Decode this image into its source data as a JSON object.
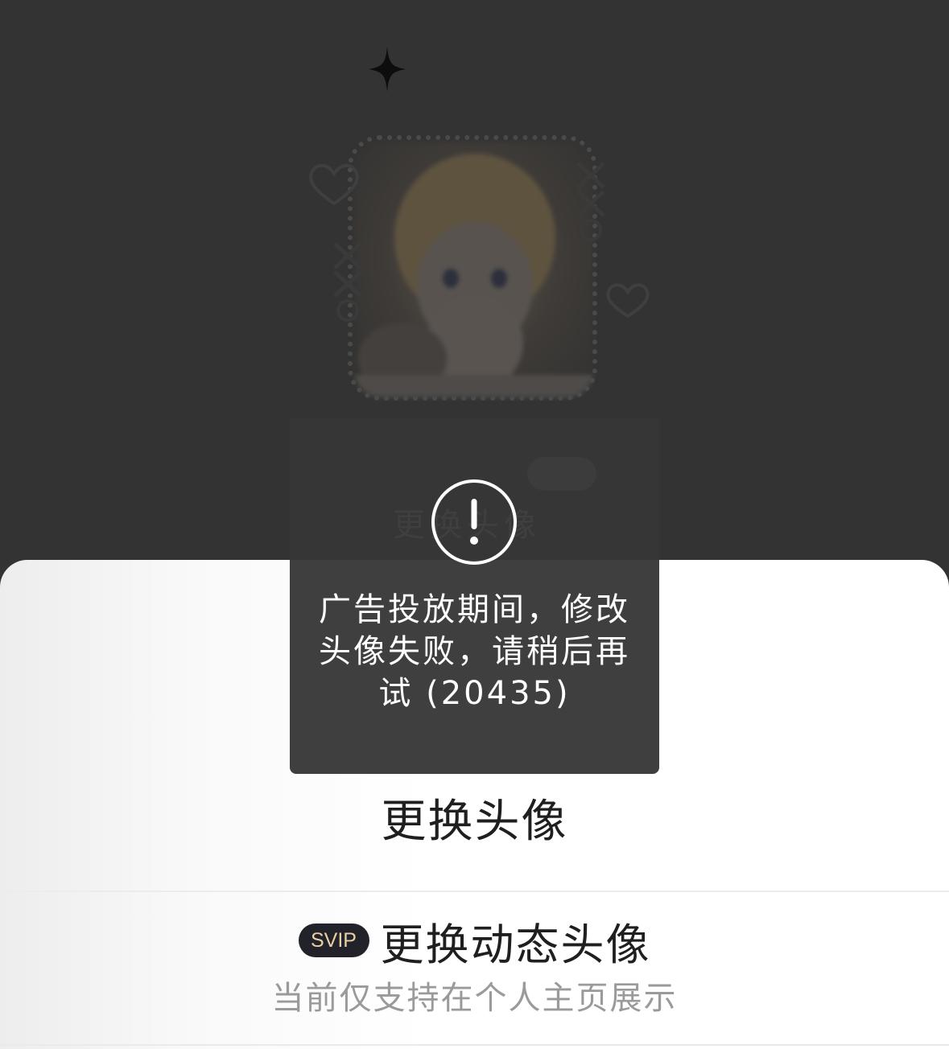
{
  "backdrop": {
    "avatar_icon": "avatar-photo",
    "sparkle_icon": "sparkle-icon"
  },
  "toast": {
    "icon": "warning-icon",
    "message": "广告投放期间，修改头像失败，请稍后再试 (20435)"
  },
  "sheet": {
    "change_avatar_label": "更换头像",
    "svip_badge": "SVIP",
    "change_dynamic_avatar_label": "更换动态头像",
    "dynamic_note": "当前仅支持在个人主页展示"
  },
  "colors": {
    "backdrop": "#333333",
    "toast": "#3f3f3f",
    "sheet": "#ffffff",
    "svip_badge_bg": "#22232a",
    "svip_badge_text": "#e8cfa4",
    "note_text": "#9a9a9a"
  }
}
